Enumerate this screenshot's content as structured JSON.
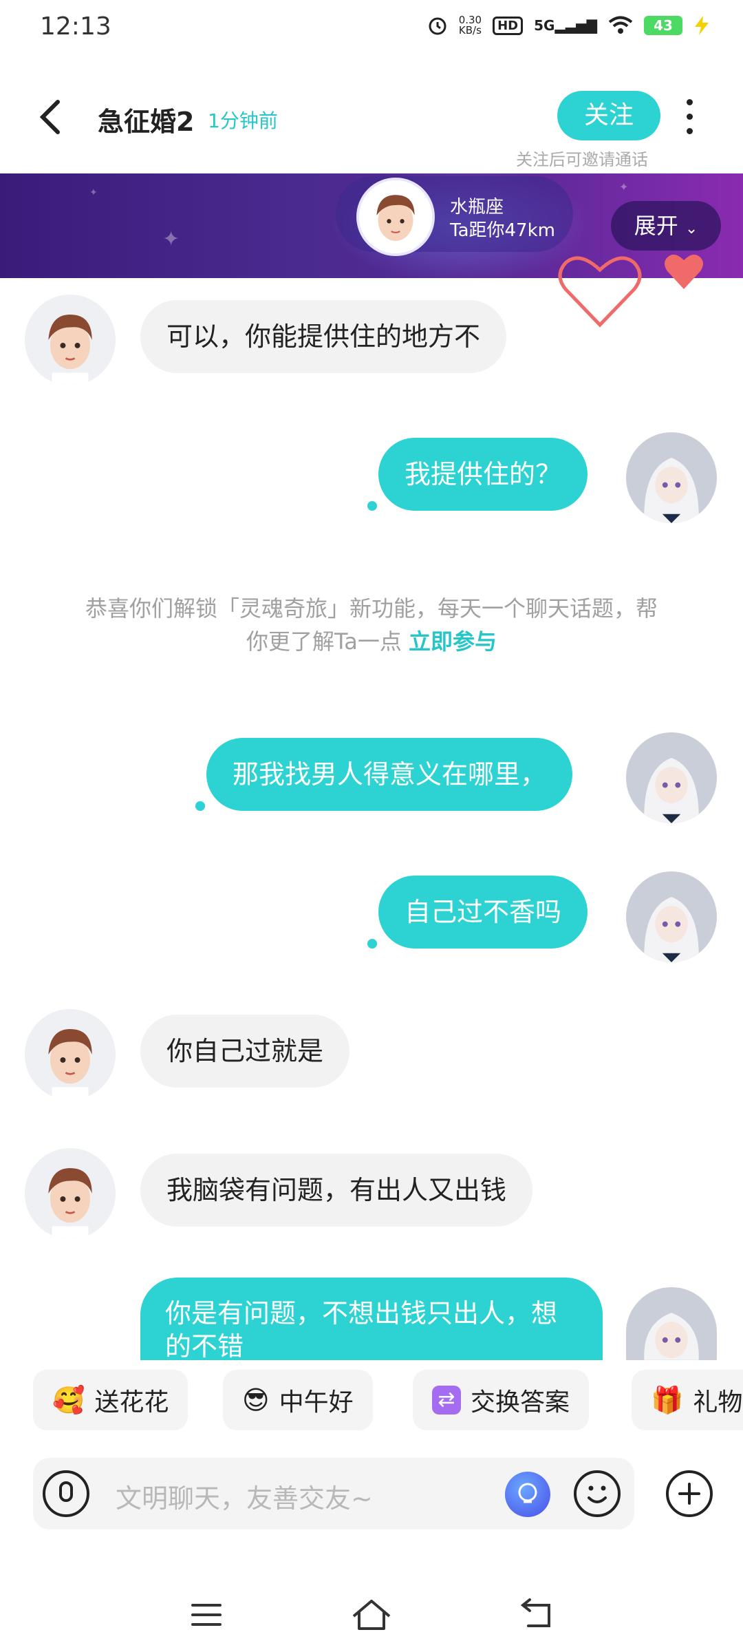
{
  "status_bar": {
    "time": "12:13",
    "net_speed_value": "0.30",
    "net_speed_unit": "KB/s",
    "hd_label": "HD",
    "network_label": "5G",
    "battery_level": "43"
  },
  "header": {
    "title": "急征婚2",
    "last_active": "1分钟前",
    "follow_label": "关注",
    "follow_hint": "关注后可邀请通话"
  },
  "banner": {
    "zodiac": "水瓶座",
    "distance": "Ta距你47km",
    "expand_label": "展开"
  },
  "messages": [
    {
      "side": "in",
      "text": "可以，你能提供住的地方不"
    },
    {
      "side": "out",
      "text": "我提供住的？"
    },
    {
      "side": "out",
      "text": "那我找男人得意义在哪里，"
    },
    {
      "side": "out",
      "text": "自己过不香吗"
    },
    {
      "side": "in",
      "text": "你自己过就是"
    },
    {
      "side": "in",
      "text": "我脑袋有问题，有出人又出钱"
    },
    {
      "side": "out",
      "text": "你是有问题，不想出钱只出人，想的不错"
    }
  ],
  "system": {
    "text_1": "恭喜你们解锁「灵魂奇旅」新功能，每天一个聊天话题，帮你更了解Ta一点",
    "link": "立即参与"
  },
  "quick_replies": [
    {
      "icon": "flower-face-icon",
      "label": "送花花"
    },
    {
      "icon": "sun-sunglasses-icon",
      "label": "中午好"
    },
    {
      "icon": "swap-icon",
      "label": "交换答案"
    },
    {
      "icon": "gift-icon",
      "label": "礼物"
    }
  ],
  "input": {
    "placeholder": "文明聊天，友善交友~"
  },
  "colors": {
    "accent": "#2dd2d2",
    "link": "#26c6c8",
    "banner_start": "#3b1b7a",
    "banner_end": "#8a2bb0",
    "heart": "#f06a6a"
  }
}
